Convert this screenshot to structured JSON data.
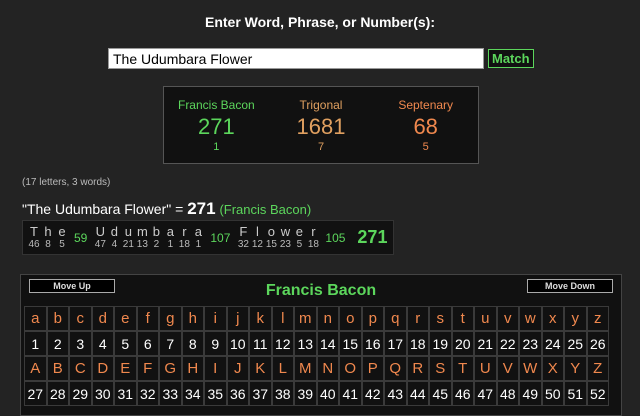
{
  "prompt": "Enter Word, Phrase, or Number(s):",
  "search": {
    "value": "The Udumbara Flower",
    "match_label": "Match"
  },
  "ciphers": [
    {
      "name": "Francis Bacon",
      "value": "271",
      "sub": "1",
      "color": "#5cd65c"
    },
    {
      "name": "Trigonal",
      "value": "1681",
      "sub": "7",
      "color": "#e0a060"
    },
    {
      "name": "Septenary",
      "value": "68",
      "sub": "5",
      "color": "#f0884e"
    }
  ],
  "count_line": "(17 letters, 3 words)",
  "equation": {
    "phrase": "\"The Udumbara Flower\"",
    "eq": " = ",
    "value": "271",
    "cipher": "(Francis Bacon)"
  },
  "breakdown": {
    "words": [
      {
        "letters": [
          [
            "T",
            "46"
          ],
          [
            "h",
            "8"
          ],
          [
            "e",
            "5"
          ]
        ],
        "sum": "59"
      },
      {
        "letters": [
          [
            "U",
            "47"
          ],
          [
            "d",
            "4"
          ],
          [
            "u",
            "21"
          ],
          [
            "m",
            "13"
          ],
          [
            "b",
            "2"
          ],
          [
            "a",
            "1"
          ],
          [
            "r",
            "18"
          ],
          [
            "a",
            "1"
          ]
        ],
        "sum": "107"
      },
      {
        "letters": [
          [
            "F",
            "32"
          ],
          [
            "l",
            "12"
          ],
          [
            "o",
            "15"
          ],
          [
            "w",
            "23"
          ],
          [
            "e",
            "5"
          ],
          [
            "r",
            "18"
          ]
        ],
        "sum": "105"
      }
    ],
    "total": "271"
  },
  "table": {
    "move_up": "Move Up",
    "move_down": "Move Down",
    "title": "Francis Bacon",
    "lower": [
      "a",
      "b",
      "c",
      "d",
      "e",
      "f",
      "g",
      "h",
      "i",
      "j",
      "k",
      "l",
      "m",
      "n",
      "o",
      "p",
      "q",
      "r",
      "s",
      "t",
      "u",
      "v",
      "w",
      "x",
      "y",
      "z"
    ],
    "lower_vals": [
      "1",
      "2",
      "3",
      "4",
      "5",
      "6",
      "7",
      "8",
      "9",
      "10",
      "11",
      "12",
      "13",
      "14",
      "15",
      "16",
      "17",
      "18",
      "19",
      "20",
      "21",
      "22",
      "23",
      "24",
      "25",
      "26"
    ],
    "upper": [
      "A",
      "B",
      "C",
      "D",
      "E",
      "F",
      "G",
      "H",
      "I",
      "J",
      "K",
      "L",
      "M",
      "N",
      "O",
      "P",
      "Q",
      "R",
      "S",
      "T",
      "U",
      "V",
      "W",
      "X",
      "Y",
      "Z"
    ],
    "upper_vals": [
      "27",
      "28",
      "29",
      "30",
      "31",
      "32",
      "33",
      "34",
      "35",
      "36",
      "37",
      "38",
      "39",
      "40",
      "41",
      "42",
      "43",
      "44",
      "45",
      "46",
      "47",
      "48",
      "49",
      "50",
      "51",
      "52"
    ]
  }
}
